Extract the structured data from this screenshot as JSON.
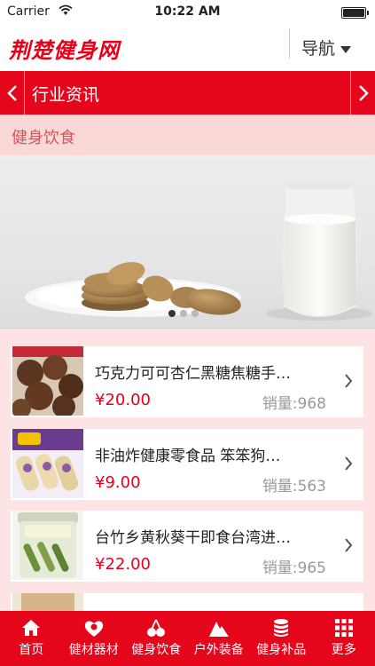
{
  "status_bar": {
    "carrier": "Carrier",
    "time": "10:22 AM"
  },
  "header": {
    "logo": "荆楚健身网",
    "nav_label": "导航"
  },
  "category_bar": {
    "title": "行业资讯"
  },
  "section_title": "健身饮食",
  "banner": {
    "slide_count": 3,
    "active_slide": 1
  },
  "products": [
    {
      "name": "巧克力可可杏仁黑糖焦糖手…",
      "price": "¥20.00",
      "sales": "销量:968",
      "thumb_icon": "chocolate-cookies-thumbnail"
    },
    {
      "name": "非油炸健康零食品 笨笨狗…",
      "price": "¥9.00",
      "sales": "销量:563",
      "thumb_icon": "snack-rolls-thumbnail"
    },
    {
      "name": "台竹乡黄秋葵干即食台湾进…",
      "price": "¥22.00",
      "sales": "销量:965",
      "thumb_icon": "okra-jar-thumbnail"
    }
  ],
  "tabs": [
    {
      "label": "首页",
      "icon": "home-icon"
    },
    {
      "label": "健材器材",
      "icon": "heart-badge-icon"
    },
    {
      "label": "健身饮食",
      "icon": "cherries-icon"
    },
    {
      "label": "户外装备",
      "icon": "mountain-icon"
    },
    {
      "label": "健身补品",
      "icon": "database-stack-icon"
    },
    {
      "label": "更多",
      "icon": "grid-icon"
    }
  ],
  "colors": {
    "brand_red": "#e5061c",
    "section_bg": "#fbd8d8",
    "price_red": "#e8001a",
    "list_bg": "#fde3e3"
  }
}
